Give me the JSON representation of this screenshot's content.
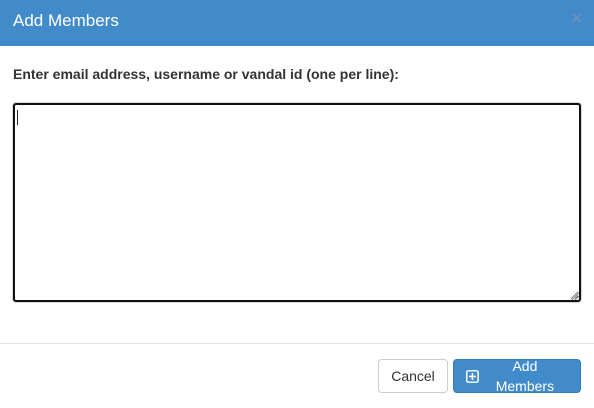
{
  "header": {
    "title": "Add Members",
    "close_label": "×"
  },
  "form": {
    "label": "Enter email address, username or vandal id (one per line):",
    "textarea_value": ""
  },
  "footer": {
    "cancel_label": "Cancel",
    "add_label": "Add Members",
    "add_icon": "plus-square-icon"
  },
  "colors": {
    "header_bg": "#428bca",
    "primary_button": "#428bca",
    "text": "#333333"
  }
}
